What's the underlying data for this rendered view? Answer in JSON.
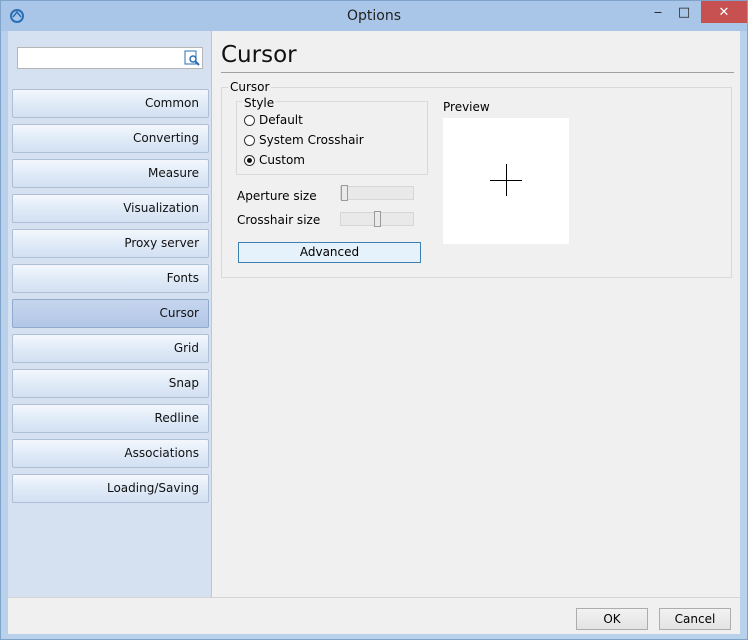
{
  "window": {
    "title": "Options",
    "minimize": "‒",
    "maximize": "□",
    "close": "✕"
  },
  "search": {
    "value": "",
    "placeholder": ""
  },
  "sidebar": {
    "items": [
      {
        "label": "Common"
      },
      {
        "label": "Converting"
      },
      {
        "label": "Measure"
      },
      {
        "label": "Visualization"
      },
      {
        "label": "Proxy server"
      },
      {
        "label": "Fonts"
      },
      {
        "label": "Cursor",
        "active": true
      },
      {
        "label": "Grid"
      },
      {
        "label": "Snap"
      },
      {
        "label": "Redline"
      },
      {
        "label": "Associations"
      },
      {
        "label": "Loading/Saving"
      }
    ]
  },
  "main": {
    "title": "Cursor",
    "group_label": "Cursor",
    "style": {
      "label": "Style",
      "options": [
        {
          "label": "Default",
          "checked": false
        },
        {
          "label": "System Crosshair",
          "checked": false
        },
        {
          "label": "Custom",
          "checked": true
        }
      ]
    },
    "aperture": {
      "label": "Aperture size",
      "value_fraction": 0.0
    },
    "crosshair": {
      "label": "Crosshair size",
      "value_fraction": 0.5
    },
    "advanced_label": "Advanced",
    "preview_label": "Preview"
  },
  "footer": {
    "ok_label": "OK",
    "cancel_label": "Cancel"
  },
  "colors": {
    "sidebar_bg": "#d5e1f1",
    "active_item": "#b2c6e6",
    "close_button": "#c75050"
  }
}
